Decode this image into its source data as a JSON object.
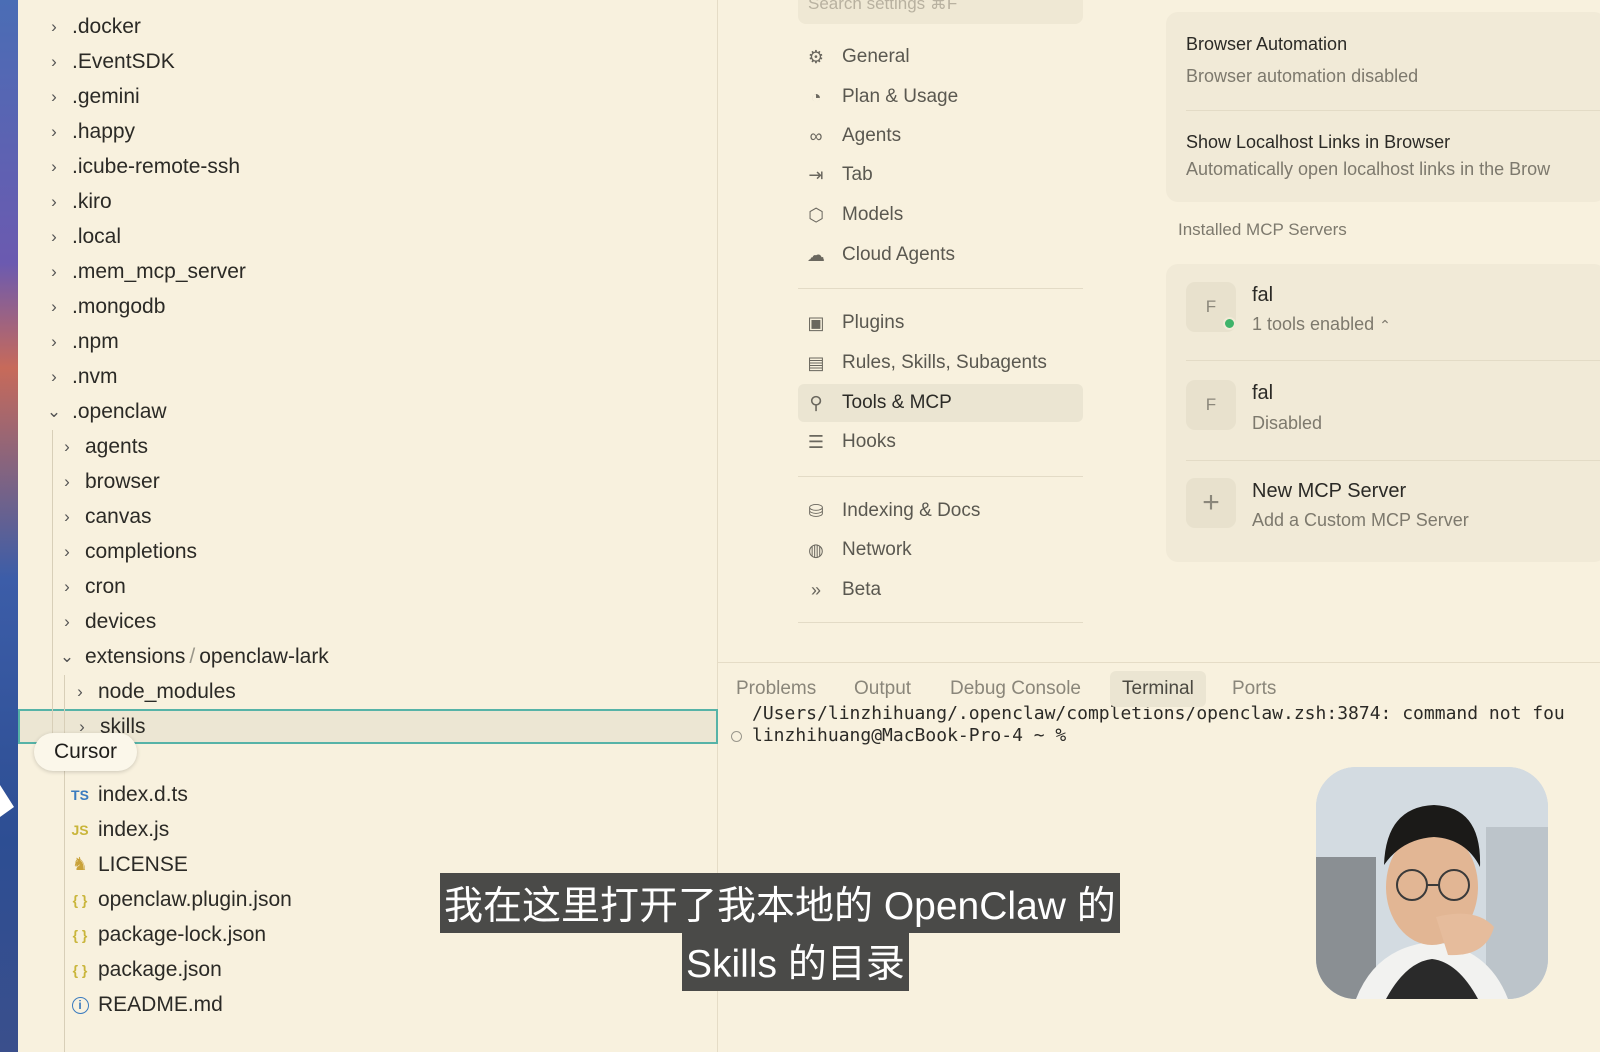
{
  "explorer": {
    "items": [
      {
        "label": ".docker",
        "expanded": false
      },
      {
        "label": ".EventSDK",
        "expanded": false
      },
      {
        "label": ".gemini",
        "expanded": false
      },
      {
        "label": ".happy",
        "expanded": false
      },
      {
        "label": ".icube-remote-ssh",
        "expanded": false
      },
      {
        "label": ".kiro",
        "expanded": false
      },
      {
        "label": ".local",
        "expanded": false
      },
      {
        "label": ".mem_mcp_server",
        "expanded": false
      },
      {
        "label": ".mongodb",
        "expanded": false
      },
      {
        "label": ".npm",
        "expanded": false
      },
      {
        "label": ".nvm",
        "expanded": false
      },
      {
        "label": ".openclaw",
        "expanded": true
      },
      {
        "label": "agents",
        "expanded": false
      },
      {
        "label": "browser",
        "expanded": false
      },
      {
        "label": "canvas",
        "expanded": false
      },
      {
        "label": "completions",
        "expanded": false
      },
      {
        "label": "cron",
        "expanded": false
      },
      {
        "label": "devices",
        "expanded": false
      },
      {
        "label": "extensions",
        "expanded": true
      },
      {
        "label": "node_modules",
        "expanded": false
      },
      {
        "label": "skills",
        "expanded": false,
        "selected": true
      }
    ],
    "extensions_child": "openclaw-lark",
    "path_separator": "/",
    "files": [
      {
        "icon": "TS",
        "icon_color": "#3b7bbf",
        "label": "index.d.ts"
      },
      {
        "icon": "JS",
        "icon_color": "#c9b53a",
        "label": "index.js"
      },
      {
        "icon": "license-icon",
        "icon_color": "#c9a23a",
        "label": "LICENSE"
      },
      {
        "icon": "{ }",
        "icon_color": "#c9b53a",
        "label": "openclaw.plugin.json"
      },
      {
        "icon": "{ }",
        "icon_color": "#c9b53a",
        "label": "package-lock.json"
      },
      {
        "icon": "{ }",
        "icon_color": "#c9b53a",
        "label": "package.json"
      },
      {
        "icon": "info-icon",
        "icon_color": "#3b7bbf",
        "label": "README.md"
      }
    ]
  },
  "cursor_tooltip": "Cursor",
  "settings": {
    "search_placeholder": "Search settings ⌘F",
    "nav": [
      {
        "icon": "gear-icon",
        "label": "General"
      },
      {
        "icon": "gauge-icon",
        "label": "Plan & Usage"
      },
      {
        "icon": "infinity-icon",
        "label": "Agents"
      },
      {
        "icon": "tab-arrow-icon",
        "label": "Tab"
      },
      {
        "icon": "cube-icon",
        "label": "Models"
      },
      {
        "icon": "cloud-icon",
        "label": "Cloud Agents"
      },
      {
        "icon": "package-icon",
        "label": "Plugins"
      },
      {
        "icon": "clipboard-icon",
        "label": "Rules, Skills, Subagents"
      },
      {
        "icon": "network-nodes-icon",
        "label": "Tools & MCP",
        "active": true
      },
      {
        "icon": "hooks-icon",
        "label": "Hooks"
      },
      {
        "icon": "database-icon",
        "label": "Indexing & Docs"
      },
      {
        "icon": "globe-icon",
        "label": "Network"
      },
      {
        "icon": "chevrons-right-icon",
        "label": "Beta"
      }
    ]
  },
  "tools_mcp": {
    "browser_automation_title": "Browser Automation",
    "browser_automation_sub": "Browser automation disabled",
    "localhost_title": "Show Localhost Links in Browser",
    "localhost_sub": "Automatically open localhost links in the Brow",
    "installed_label": "Installed MCP Servers",
    "servers": [
      {
        "avatar": "F",
        "name": "fal",
        "status": "1 tools enabled",
        "status_color": "#3fb36a"
      },
      {
        "avatar": "F",
        "name": "fal",
        "status": "Disabled"
      }
    ],
    "new_server_title": "New MCP Server",
    "new_server_sub": "Add a Custom MCP Server"
  },
  "panel": {
    "tabs": [
      "Problems",
      "Output",
      "Debug Console",
      "Terminal",
      "Ports"
    ],
    "active_tab": "Terminal",
    "terminal_lines": [
      "/Users/linzhihuang/.openclaw/completions/openclaw.zsh:3874: command not fou",
      "linzhihuang@MacBook-Pro-4 ~ %"
    ]
  },
  "subtitles": {
    "line1": "我在这里打开了我本地的 OpenClaw 的",
    "line2": "Skills 的目录"
  }
}
